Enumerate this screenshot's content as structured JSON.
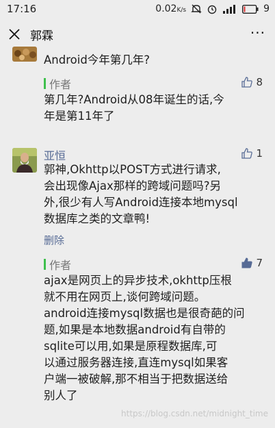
{
  "status_bar": {
    "time": "17:16",
    "speed": "0.02",
    "speed_unit": "K/s",
    "battery_level": "9",
    "icons": [
      "mute-icon",
      "alarm-icon",
      "signal-icon",
      "battery-icon"
    ]
  },
  "nav": {
    "title": "郭霖",
    "close_icon": "close-icon",
    "more_label": "···"
  },
  "comments": {
    "first": {
      "text": "Android今年第几年?",
      "reply": {
        "author_label": "作者",
        "likes": "8",
        "text_line1": "第几年?Android从08年诞生的话,今",
        "text_line2": "年是第11年了"
      }
    },
    "second": {
      "username": "亚恒",
      "likes": "1",
      "lines": [
        "郭神,Okhttp以POST方式进行请求,",
        "会出现像Ajax那样的跨域问题吗?另",
        "外,很少有人写Android连接本地mysql",
        "数据库之类的文章鸭!"
      ],
      "delete_label": "删除",
      "reply": {
        "author_label": "作者",
        "likes": "7",
        "lines": [
          "ajax是网页上的异步技术,okhttp压根",
          "就不用在网页上,谈何跨域问题。",
          "android连接mysql数据也是很奇葩的问",
          "题,如果是本地数据android有自带的",
          "sqlite可以用,如果是原程数据库,可",
          "以通过服务器连接,直连mysql如果客",
          "户端一被破解,那不相当于把数据送给",
          "别人了"
        ]
      }
    }
  },
  "watermark": "https://blog.csdn.net/midnight_time",
  "colors": {
    "background": "#ededed",
    "link": "#576b95",
    "author_bar": "#3ec04c"
  }
}
